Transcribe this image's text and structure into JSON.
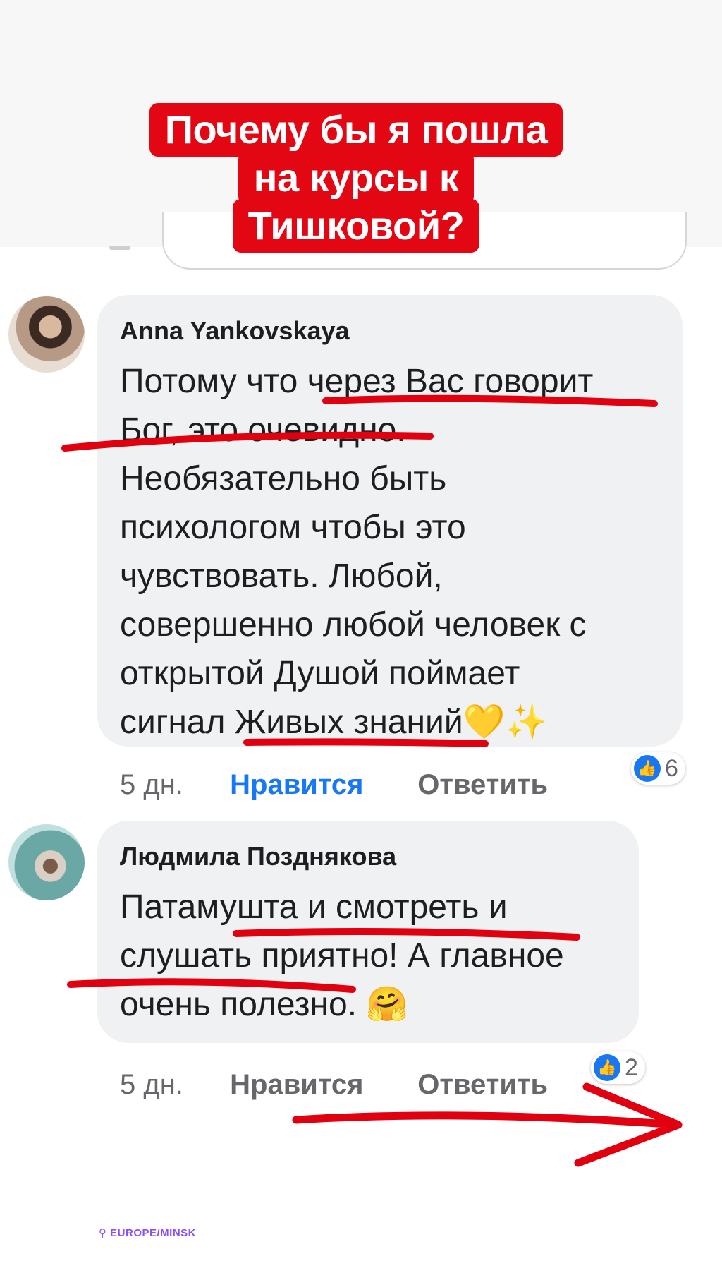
{
  "story_title": {
    "line1": "Почему бы я пошла",
    "line2": "на курсы к",
    "line3": "Тишковой?"
  },
  "comments": [
    {
      "author": "Anna Yankovskaya",
      "lines": [
        "Потому что через Вас говорит",
        "Бог, это очевидно.",
        "Необязательно быть",
        "психологом чтобы это",
        "чувствовать. Любой,",
        "совершенно любой человек с",
        "открытой Душой поймает",
        "сигнал Живых знаний"
      ],
      "emojis": "💛✨",
      "time": "5 дн.",
      "like_label": "Нравится",
      "reply_label": "Ответить",
      "reaction_count": "6"
    },
    {
      "author": "Людмила Позднякова",
      "lines": [
        "Патамушта и смотреть и",
        "слушать приятно! А главное",
        "очень полезно."
      ],
      "emojis": "🤗",
      "time": "5 дн.",
      "like_label": "Нравится",
      "reply_label": "Ответить",
      "reaction_count": "2"
    }
  ],
  "location_tag": "⚲ EUROPE/MINSK",
  "colors": {
    "banner_red": "#e30613",
    "annotation_red": "#e0000f",
    "like_blue": "#1877f2",
    "bubble_gray": "#f0f1f3"
  },
  "icons": [
    "like-thumb-icon",
    "avatar",
    "location-pin-icon"
  ]
}
